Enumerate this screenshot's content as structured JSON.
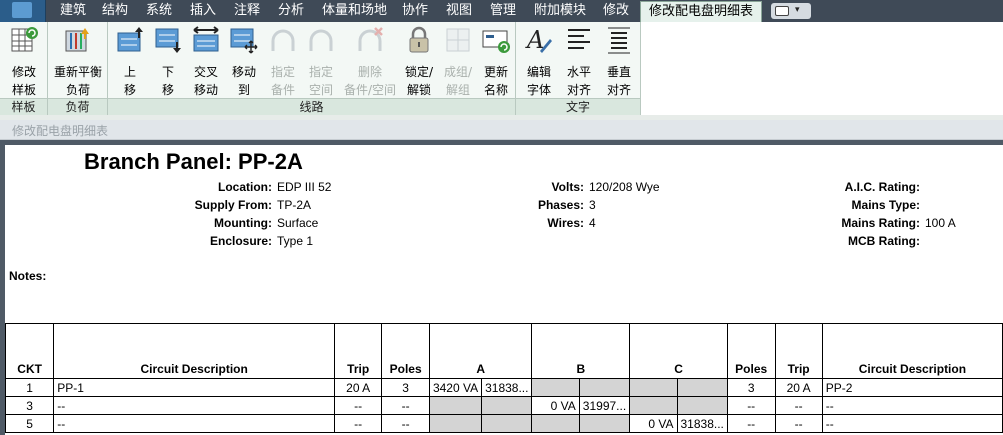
{
  "menu": {
    "tabs": [
      "建筑",
      "结构",
      "系统",
      "插入",
      "注释",
      "分析",
      "体量和场地",
      "协作",
      "视图",
      "管理",
      "附加模块",
      "修改",
      "修改配电盘明细表"
    ]
  },
  "ribbon": {
    "panels": [
      {
        "label": "样板",
        "buttons": [
          {
            "label": "修改\n样板",
            "icon": "modify-template-icon"
          }
        ]
      },
      {
        "label": "负荷",
        "buttons": [
          {
            "label": "重新平衡\n负荷",
            "icon": "rebalance-loads-icon"
          }
        ]
      },
      {
        "label": "线路",
        "buttons": [
          {
            "label": "上\n移",
            "icon": "move-up-icon"
          },
          {
            "label": "下\n移",
            "icon": "move-down-icon"
          },
          {
            "label": "交叉\n移动",
            "icon": "move-across-icon"
          },
          {
            "label": "移动\n到",
            "icon": "move-to-icon"
          },
          {
            "label": "指定\n备件",
            "icon": "assign-spare-icon",
            "disabled": true
          },
          {
            "label": "指定\n空间",
            "icon": "assign-space-icon",
            "disabled": true
          },
          {
            "label": "删除\n备件/空间",
            "icon": "delete-spare-space-icon",
            "disabled": true
          },
          {
            "label": "锁定/\n解锁",
            "icon": "lock-icon"
          },
          {
            "label": "成组/\n解组",
            "icon": "group-icon",
            "disabled": true
          },
          {
            "label": "更新\n名称",
            "icon": "update-names-icon"
          }
        ]
      },
      {
        "label": "文字",
        "buttons": [
          {
            "label": "编辑\n字体",
            "icon": "edit-font-icon"
          },
          {
            "label": "水平\n对齐",
            "icon": "horizontal-align-icon"
          },
          {
            "label": "垂直\n对齐",
            "icon": "vertical-align-icon"
          }
        ]
      }
    ]
  },
  "context_bar": {
    "label": "修改配电盘明细表"
  },
  "schedule": {
    "title": "Branch Panel: PP-2A",
    "fields_left": [
      {
        "key": "Location:",
        "value": "EDP III 52"
      },
      {
        "key": "Supply From:",
        "value": "TP-2A"
      },
      {
        "key": "Mounting:",
        "value": "Surface"
      },
      {
        "key": "Enclosure:",
        "value": "Type 1"
      }
    ],
    "fields_mid": [
      {
        "key": "Volts:",
        "value": "120/208 Wye"
      },
      {
        "key": "Phases:",
        "value": "3"
      },
      {
        "key": "Wires:",
        "value": "4"
      }
    ],
    "fields_right": [
      {
        "key": "A.I.C. Rating:",
        "value": ""
      },
      {
        "key": "Mains Type:",
        "value": ""
      },
      {
        "key": "Mains Rating:",
        "value": "100 A"
      },
      {
        "key": "MCB Rating:",
        "value": ""
      }
    ],
    "notes_label": "Notes:",
    "columns": [
      "CKT",
      "Circuit Description",
      "Trip",
      "Poles",
      "A",
      "B",
      "C",
      "Poles",
      "Trip",
      "Circuit Description"
    ],
    "rows": [
      {
        "ckt": "1",
        "desc": "PP-1",
        "trip": "20 A",
        "poles": "3",
        "a1": "3420 VA",
        "a2": "31838...",
        "b1": "",
        "b2": "",
        "c1": "",
        "c2": "",
        "poles2": "3",
        "trip2": "20 A",
        "desc2": "PP-2"
      },
      {
        "ckt": "3",
        "desc": "--",
        "trip": "--",
        "poles": "--",
        "a1": "",
        "a2": "",
        "b1": "0 VA",
        "b2": "31997...",
        "c1": "",
        "c2": "",
        "poles2": "--",
        "trip2": "--",
        "desc2": "--"
      },
      {
        "ckt": "5",
        "desc": "--",
        "trip": "--",
        "poles": "--",
        "a1": "",
        "a2": "",
        "b1": "",
        "b2": "",
        "c1": "0 VA",
        "c2": "31838...",
        "poles2": "--",
        "trip2": "--",
        "desc2": "--"
      }
    ]
  }
}
